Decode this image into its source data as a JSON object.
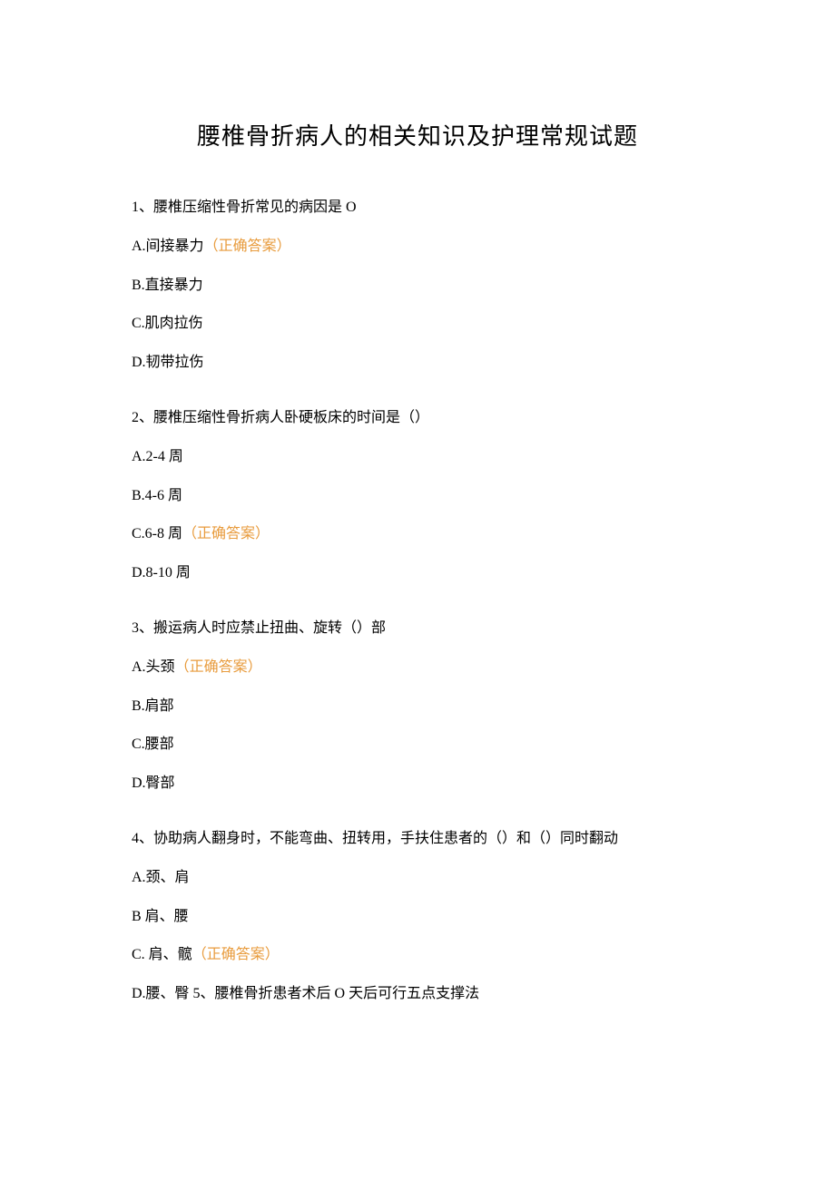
{
  "title": "腰椎骨折病人的相关知识及护理常规试题",
  "questions": [
    {
      "text": "1、腰椎压缩性骨折常见的病因是 O",
      "options": [
        {
          "label": "A.间接暴力",
          "correct": true
        },
        {
          "label": "B.直接暴力",
          "correct": false
        },
        {
          "label": "C.肌肉拉伤",
          "correct": false
        },
        {
          "label": "D.韧带拉伤",
          "correct": false
        }
      ]
    },
    {
      "text": "2、腰椎压缩性骨折病人卧硬板床的时间是（）",
      "options": [
        {
          "label": "A.2-4 周",
          "correct": false
        },
        {
          "label": "B.4-6 周",
          "correct": false
        },
        {
          "label": "C.6-8 周",
          "correct": true
        },
        {
          "label": "D.8-10 周",
          "correct": false
        }
      ]
    },
    {
      "text": "3、搬运病人时应禁止扭曲、旋转（）部",
      "options": [
        {
          "label": "A.头颈",
          "correct": true
        },
        {
          "label": "B.肩部",
          "correct": false
        },
        {
          "label": "C.腰部",
          "correct": false
        },
        {
          "label": "D.臀部",
          "correct": false
        }
      ]
    },
    {
      "text": "4、协助病人翻身时，不能弯曲、扭转用，手扶住患者的（）和（）同时翻动",
      "options": [
        {
          "label": "A.颈、肩",
          "correct": false
        },
        {
          "label": "B 肩、腰",
          "correct": false
        },
        {
          "label": "C. 肩、髋",
          "correct": true
        },
        {
          "label": "D.腰、臀 5、腰椎骨折患者术后 O 天后可行五点支撑法",
          "correct": false
        }
      ]
    }
  ],
  "correctLabel": "（正确答案）"
}
